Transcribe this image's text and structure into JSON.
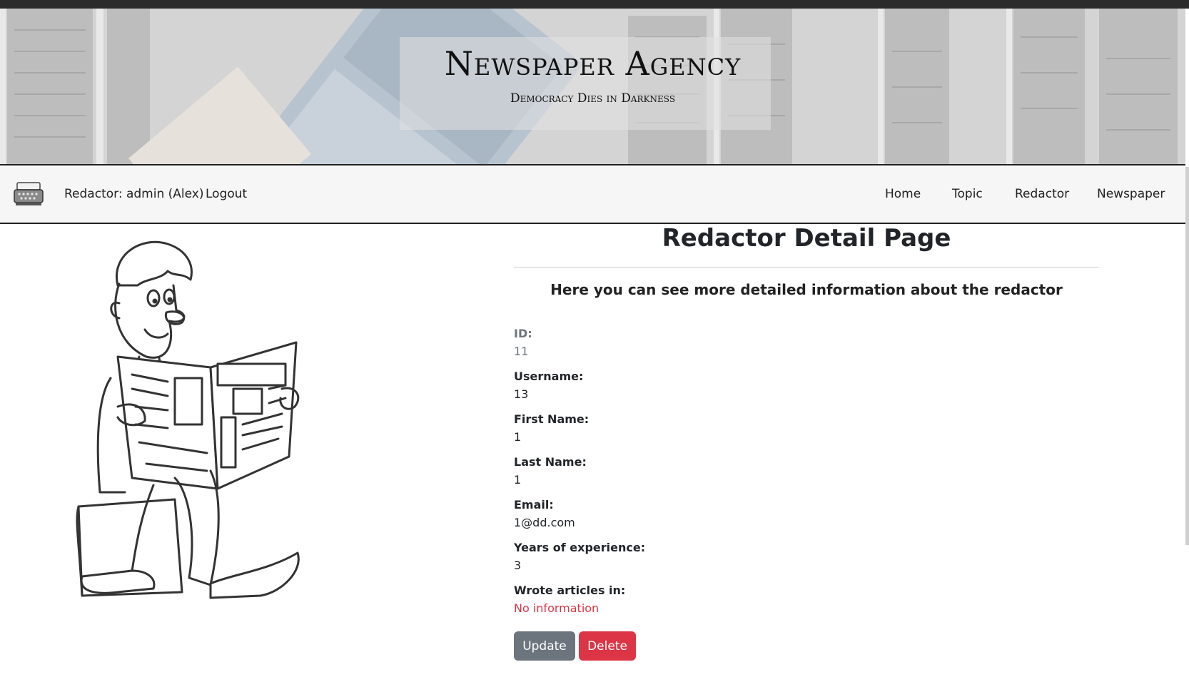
{
  "header": {
    "title": "Newspaper Agency",
    "subtitle": "Democracy Dies in Darkness"
  },
  "navbar": {
    "logo_icon": "typewriter-icon",
    "user_label": "Redactor: admin (Alex)",
    "logout_label": "Logout",
    "links": [
      "Home",
      "Topic",
      "Redactor",
      "Newspaper"
    ]
  },
  "main": {
    "title": "Redactor Detail Page",
    "subtitle": "Here you can see more detailed information about the redactor",
    "illustration_icon": "man-reading-newspaper-icon",
    "fields": [
      {
        "label": "ID:",
        "value": "11"
      },
      {
        "label": "Username:",
        "value": "13"
      },
      {
        "label": "First Name:",
        "value": "1"
      },
      {
        "label": "Last Name:",
        "value": "1"
      },
      {
        "label": "Email:",
        "value": "1@dd.com"
      },
      {
        "label": "Years of experience:",
        "value": "3"
      },
      {
        "label": "Wrote articles in:",
        "value": "No information"
      }
    ],
    "buttons": {
      "update": "Update",
      "delete": "Delete"
    },
    "colors": {
      "secondary": "#6c757d",
      "danger": "#dc3545"
    }
  }
}
